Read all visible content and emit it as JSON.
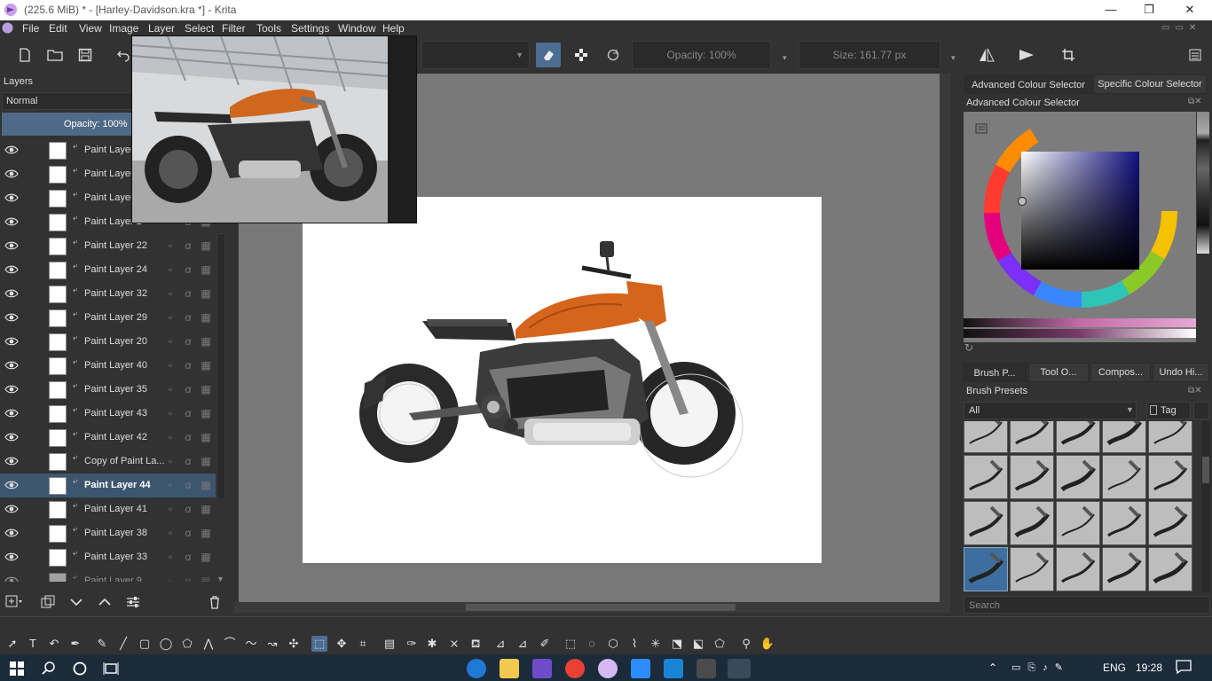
{
  "window": {
    "title": "(225.6 MiB)  * - [Harley-Davidson.kra *] - Krita",
    "controls": [
      "—",
      "❐",
      "✕"
    ]
  },
  "menu": [
    "File",
    "Edit",
    "View",
    "Image",
    "Layer",
    "Select",
    "Filter",
    "Tools",
    "Settings",
    "Window",
    "Help"
  ],
  "toolbar": {
    "opacity_label": "Opacity: 100%",
    "size_label": "Size: 161.77 px"
  },
  "layers_panel": {
    "title": "Layers",
    "blend_mode": "Normal",
    "opacity": "Opacity:  100%",
    "layers": [
      {
        "name": "Paint Layer",
        "selected": false
      },
      {
        "name": "Paint Layer",
        "selected": false
      },
      {
        "name": "Paint Layer",
        "selected": false
      },
      {
        "name": "Paint Layer 2",
        "selected": false
      },
      {
        "name": "Paint Layer 22",
        "selected": false
      },
      {
        "name": "Paint Layer 24",
        "selected": false
      },
      {
        "name": "Paint Layer 32",
        "selected": false
      },
      {
        "name": "Paint Layer 29",
        "selected": false
      },
      {
        "name": "Paint Layer 20",
        "selected": false
      },
      {
        "name": "Paint Layer 40",
        "selected": false
      },
      {
        "name": "Paint Layer 35",
        "selected": false
      },
      {
        "name": "Paint Layer 43",
        "selected": false
      },
      {
        "name": "Paint Layer 42",
        "selected": false
      },
      {
        "name": "Copy of Paint La...",
        "selected": false
      },
      {
        "name": "Paint Layer 44",
        "selected": true
      },
      {
        "name": "Paint Layer 41",
        "selected": false
      },
      {
        "name": "Paint Layer 38",
        "selected": false
      },
      {
        "name": "Paint Layer 33",
        "selected": false
      },
      {
        "name": "Paint Layer 9",
        "selected": false
      }
    ]
  },
  "colour_panel": {
    "tab_advanced": "Advanced Colour Selector",
    "tab_specific": "Specific Colour Selector",
    "header": "Advanced Colour Selector"
  },
  "brush_panel": {
    "tabs": [
      "Brush P...",
      "Tool O...",
      "Compos...",
      "Undo Hi..."
    ],
    "header": "Brush Presets",
    "filter": "All",
    "tag_label": "Tag",
    "search_placeholder": "Search"
  },
  "taskbar": {
    "language": "ENG",
    "time": "19:28"
  }
}
